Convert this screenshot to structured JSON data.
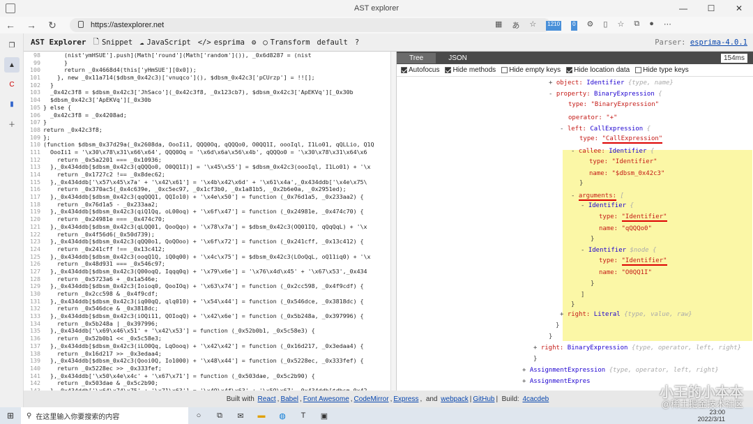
{
  "browser": {
    "title": "AST explorer",
    "url": "https://astexplorer.net",
    "badges": [
      "1210",
      "0"
    ]
  },
  "toolbar": {
    "brand": "AST Explorer",
    "snippet": "Snippet",
    "language": "JavaScript",
    "parser_name": "esprima",
    "transform": "Transform",
    "default": "default",
    "help": "?",
    "parser_label": "Parser:",
    "parser_version": "esprima-4.0.1"
  },
  "editor": {
    "lines": [
      [
        "98",
        "      (nist'ymHSUE'].push](Math['round'](Math['random']()), _0x6d8287 = (nist"
      ],
      [
        "99",
        "      }"
      ],
      [
        "100",
        "      return _0x4668d4(this['yHmSUE'][0x0]);"
      ],
      [
        "101",
        "    }, new _0x11a714($dbsm_0x42c3)['vnuqco'](), $dbsm_0x42c3['pCUrzp'] = !![];"
      ],
      [
        "102",
        "  }"
      ],
      [
        "103",
        "  _0x42c3f8 = $dbsm_0x42c3['JhSaco'](_0x42c3f8, _0x123cb7), $dbsm_0x42c3['ApEKVq'][_0x30b"
      ],
      [
        "104",
        "  $dbsm_0x42c3['ApEKVq'][_0x30b"
      ],
      [
        "105",
        "} else {"
      ],
      [
        "106",
        "  _0x42c3f8 = _0x4208ad;"
      ],
      [
        "107",
        "}"
      ],
      [
        "108",
        "return _0x42c3f8;"
      ],
      [
        "109",
        "};"
      ],
      [
        "110",
        "(function $dbsm_0x37d29a(_0x2608da, OooIi1, QQQ0Oq, qQQQo0, O0QQ1I, oooIql, I1Lo01, qQLLio, Q1Q"
      ],
      [
        "111",
        "  OooIi1 = '\\x30\\x78\\x31\\x66\\x64', QQQ0Oq = '\\x6d\\x6a\\x56\\x4b', qQQQo0 = '\\x30\\x78\\x31\\x64\\x6"
      ],
      [
        "112",
        "    return _0x5a2201 === _0x10936;"
      ],
      [
        "113",
        "  },_0x434ddb[$dbsm_0x42c3(qQQQo0, O0QQ1I)] = '\\x45\\x55'] = $dbsm_0x42c3(oooIql, I1Lo01) + '\\x"
      ],
      [
        "114",
        "    return _0x1727c2 !== _0x8dec62;"
      ],
      [
        "115",
        "  },_0x434ddb['\\x57\\x45\\x7a' + '\\x42\\x61'] = '\\x4b\\x42\\x6d' + '\\x61\\x4a',_0x434ddb['\\x4e\\x75\\"
      ],
      [
        "116",
        "    return _0x370ac5(_0x4c639e, _0xc5ec97, _0x1cf3b0, _0x1a81b5, _0x2b6e0a, _0x2951ed);"
      ],
      [
        "117",
        "  },_0x434ddb[$dbsm_0x42c3(qqQQQ1, QQIo10) + '\\x4e\\x50'] = function (_0x76d1a5, _0x233aa2) {"
      ],
      [
        "118",
        "    return _0x76d1a5 - _0x233aa2;"
      ],
      [
        "119",
        "  },_0x434ddb[$dbsm_0x42c3(qiQ1Qq, oL00oq) + '\\x6f\\x47'] = function (_0x24981e, _0x474c70) {"
      ],
      [
        "120",
        "    return _0x24981e === _0x474c70;"
      ],
      [
        "121",
        "  },_0x434ddb[$dbsm_0x42c3(qLQQ01, QooQqo) + '\\x78\\x7a'] = $dbsm_0x42c3(OQ01IQ, qQqQqL) + '\\x"
      ],
      [
        "122",
        "    return _0x4f56d6(_0x50d739);"
      ],
      [
        "123",
        "  },_0x434ddb[$dbsm_0x42c3(qQQ0o1, QoQOoo) + '\\x6f\\x72'] = function (_0x241cff, _0x13c412) {"
      ],
      [
        "124",
        "    return _0x241cff !== _0x13c412;"
      ],
      [
        "125",
        "  },_0x434ddb[$dbsm_0x42c3(ooqQ1Q, iQ0q00) + '\\x4c\\x75'] = $dbsm_0x42c3(LOoQqL, oQ11iq0) + '\\x"
      ],
      [
        "126",
        "    return _0x48d931 === _0x546c97;"
      ],
      [
        "127",
        "  },_0x434ddb[$dbsm_0x42c3(Q00oqQ, Iqqq0q) + '\\x79\\x6e'] = '\\x76\\x4d\\x45' + '\\x67\\x53',_0x434"
      ],
      [
        "128",
        "    return _0x5723a6 + _0x1a546e;"
      ],
      [
        "129",
        "  },_0x434ddb[$dbsm_0x42c3(Ioioq0, QooIOq) + '\\x63\\x74'] = function (_0x2cc598, _0x4f9cdf) {"
      ],
      [
        "130",
        "    return _0x2cc598 & _0x4f9cdf;"
      ],
      [
        "131",
        "  },_0x434ddb[$dbsm_0x42c3(iq00qQ, qlq010) + '\\x54\\x44'] = function (_0x546dce, _0x3818dc) {"
      ],
      [
        "132",
        "    return _0x546dce & _0x3818dc;"
      ],
      [
        "133",
        "  },_0x434ddb[$dbsm_0x42c3(iOQi11, QOIoqQ) + '\\x42\\x6e'] = function (_0x5b248a, _0x397996) {"
      ],
      [
        "134",
        "    return _0x5b248a | _0x397996;"
      ],
      [
        "135",
        "  },_0x434ddb['\\x69\\x46\\x51' + '\\x42\\x53'] = function (_0x52b0b1, _0x5c58e3) {"
      ],
      [
        "136",
        "    return _0x52b0b1 << _0x5c58e3;"
      ],
      [
        "137",
        "  },_0x434ddb[$dbsm_0x42c3(iLO0Qq, LqOooq) + '\\x42\\x42'] = function (_0x16d217, _0x3edaa4) {"
      ],
      [
        "138",
        "    return _0x16d217 >> _0x3edaa4;"
      ],
      [
        "139",
        "  },_0x434ddb[$dbsm_0x42c3(Qooi0Q, Io1000) + '\\x48\\x44'] = function (_0x5228ec, _0x333fef) {"
      ],
      [
        "140",
        "    return _0x5228ec >> _0x333fef;"
      ],
      [
        "141",
        "  },_0x434ddb['\\x50\\x4e\\x4c' + '\\x67\\x71'] = function (_0x503dae, _0x5c2b90) {"
      ],
      [
        "142",
        "    return _0x503dae & _0x5c2b90;"
      ],
      [
        "143",
        "  },_0x434ddb['\\x64\\x74\\x75' + '\\x71\\x63'] = '\\x49\\x4f\\x63' + '\\x59\\x67',_0x434ddb[$dbsm_0x42"
      ]
    ]
  },
  "panel": {
    "tab_tree": "Tree",
    "tab_json": "JSON",
    "time": "154ms",
    "options": [
      "Autofocus",
      "Hide methods",
      "Hide empty keys",
      "Hide location data",
      "Hide type keys"
    ],
    "options_checked": [
      true,
      true,
      false,
      true,
      false
    ]
  },
  "tree": {
    "object_key": "object:",
    "object_type": "Identifier",
    "object_meta": "{type, name}",
    "property_key": "property:",
    "property_type": "BinaryExpression",
    "property_brace": "{",
    "type_key": "type:",
    "bin_type_val": "\"BinaryExpression\"",
    "operator_key": "operator:",
    "operator_val": "\"+\"",
    "left_key": "left:",
    "left_type": "CallExpression",
    "left_brace": "{",
    "call_type_val": "\"CallExpression\"",
    "callee_key": "callee:",
    "callee_type": "Identifier",
    "callee_brace": "{",
    "id_type_val": "\"Identifier\"",
    "name_key": "name:",
    "callee_name_val": "\"$dbsm_0x42c3\"",
    "close_brace": "}",
    "arguments_key": "arguments:",
    "arguments_bracket": "[",
    "arg_identifier": "Identifier",
    "arg_brace": "{",
    "arg1_name_val": "\"qQQQo0\"",
    "arg2_meta": "$node",
    "arg2_name_val": "\"O0QQ1I\"",
    "close_bracket": "]",
    "right_key": "right:",
    "right_type": "Literal",
    "right_meta": "{type, value, raw}",
    "right2_key": "right:",
    "right2_type": "BinaryExpression",
    "right2_meta": "{type, operator, left, right}",
    "assign_type": "AssignmentExpression",
    "assign_meta": "{type, operator, left, right}",
    "assign2_type": "AssignmentExpres"
  },
  "footer": {
    "built": "Built with",
    "react": "React",
    "babel": "Babel",
    "fa": "Font Awesome",
    "cm": "CodeMirror",
    "express": "Express",
    "and": "and",
    "webpack": "webpack",
    "github": "GitHub",
    "build": "Build:",
    "hash": "4cacdeb"
  },
  "taskbar": {
    "search": "在这里输入你要搜索的内容",
    "time": "23:00",
    "date": "2022/3/11"
  },
  "watermark": {
    "line1": "小王的小本本",
    "line2": "@稀土掘金技术社区"
  }
}
